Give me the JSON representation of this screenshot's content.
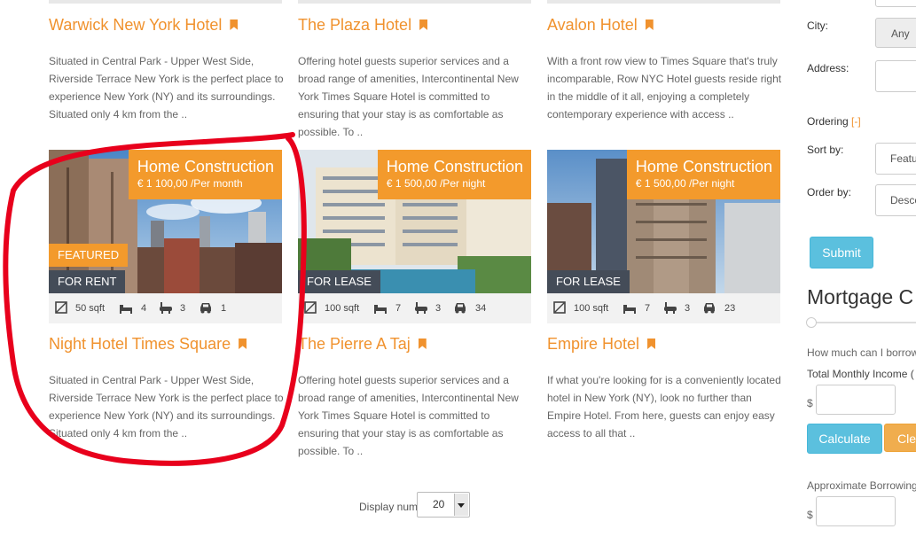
{
  "listings": [
    {
      "title": "Warwick New York Hotel",
      "desc": "Situated in Central Park - Upper West Side, Riverside Terrace New York is the perfect place to experience New York (NY) and its surroundings. Situated only 4 km from the .."
    },
    {
      "title": "The Plaza Hotel",
      "desc": "Offering hotel guests superior services and a broad range of amenities, Intercontinental New York Times Square Hotel is committed to ensuring that your stay is as comfortable as possible. To .."
    },
    {
      "title": "Avalon Hotel",
      "desc": "With a front row view to Times Square that's truly incomparable, Row NYC Hotel guests reside right in the middle of it all, enjoying a completely contemporary experience with access .."
    },
    {
      "title": "Night Hotel Times Square",
      "desc": "Situated in Central Park - Upper West Side, Riverside Terrace New York is the perfect place to experience New York (NY) and its surroundings. Situated only 4 km from the ..",
      "category": "Home Construction",
      "price": "€ 1 100,00 /Per month",
      "featured": "FEATURED",
      "status": "FOR RENT",
      "area": "50 sqft",
      "beds": "4",
      "baths": "3",
      "garages": "1"
    },
    {
      "title": "The Pierre A Taj",
      "desc": "Offering hotel guests superior services and a broad range of amenities, Intercontinental New York Times Square Hotel is committed to ensuring that your stay is as comfortable as possible. To ..",
      "category": "Home Construction",
      "price": "€ 1 500,00 /Per night",
      "status": "FOR LEASE",
      "area": "100 sqft",
      "beds": "7",
      "baths": "3",
      "garages": "34"
    },
    {
      "title": "Empire Hotel",
      "desc": "If what you're looking for is a conveniently located hotel in New York (NY), look no further than Empire Hotel. From here, guests can enjoy easy access to all that ..",
      "category": "Home Construction",
      "price": "€ 1 500,00 /Per night",
      "status": "FOR LEASE",
      "area": "100 sqft",
      "beds": "7",
      "baths": "3",
      "garages": "23"
    }
  ],
  "pagination": {
    "display_label": "Display num",
    "display_value": "20"
  },
  "sidebar": {
    "city_label": "City:",
    "city_value": "Any",
    "address_label": "Address:",
    "ordering_label": "Ordering",
    "ordering_toggle": "[-]",
    "sortby_label": "Sort by:",
    "sortby_value": "Featu",
    "orderby_label": "Order by:",
    "orderby_value": "Desce",
    "submit": "Submit",
    "mortgage_title": "Mortgage C",
    "borrow_q": "How much can I borrow",
    "income_label": "Total Monthly Income (",
    "currency": "$",
    "calculate": "Calculate",
    "clear": "Clea",
    "approx_label": "Approximate Borrowing"
  },
  "colors": {
    "accent": "#f39a2c",
    "title": "#f0922e",
    "info_btn": "#5bc0de",
    "warn_btn": "#f0ad4e",
    "dark_tag": "#444c58",
    "annotation": "#e8001c"
  },
  "icons": {
    "area": "area-icon",
    "bed": "bed-icon",
    "bath": "bath-icon",
    "car": "car-icon",
    "bookmark": "bookmark-icon"
  }
}
